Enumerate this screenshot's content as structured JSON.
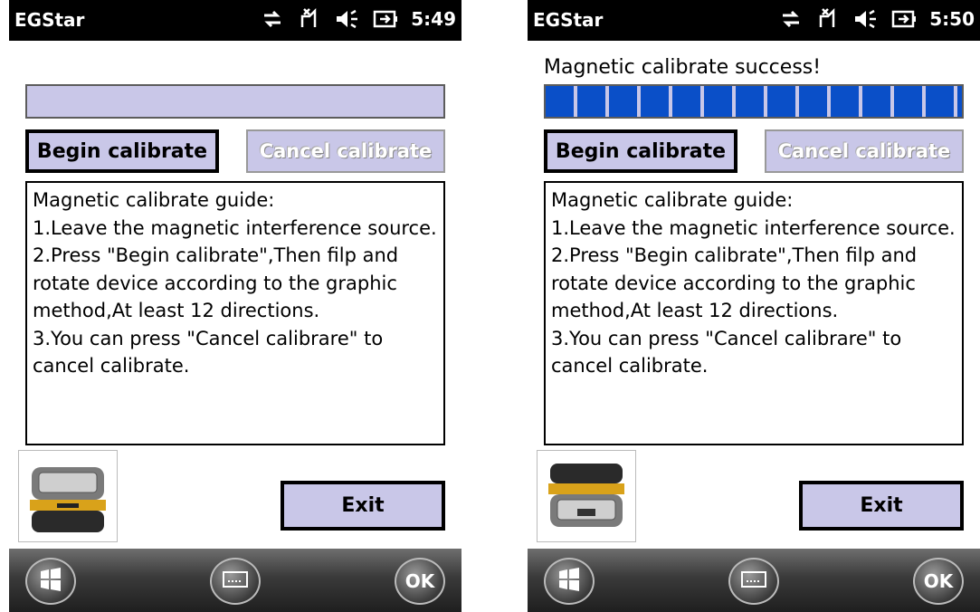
{
  "screens": [
    {
      "app_title": "EGStar",
      "time": "5:49",
      "message": "",
      "progress_percent": 0,
      "begin_label": "Begin calibrate",
      "cancel_label": "Cancel calibrate",
      "guide_lines": [
        "Magnetic calibrate guide:",
        "1.Leave the magnetic interference source.",
        "2.Press \"Begin calibrate\",Then filp and rotate device according to the graphic method,At least 12 directions.",
        "3.You can press \"Cancel calibrare\" to cancel calibrate."
      ],
      "exit_label": "Exit",
      "ok_label": "OK"
    },
    {
      "app_title": "EGStar",
      "time": "5:50",
      "message": "Magnetic calibrate success!",
      "progress_percent": 100,
      "begin_label": "Begin calibrate",
      "cancel_label": "Cancel calibrate",
      "guide_lines": [
        "Magnetic calibrate guide:",
        "1.Leave the magnetic interference source.",
        "2.Press \"Begin calibrate\",Then filp and rotate device according to the graphic method,At least 12 directions.",
        "3.You can press \"Cancel calibrare\" to cancel calibrate."
      ],
      "exit_label": "Exit",
      "ok_label": "OK"
    }
  ],
  "colors": {
    "button_fill": "#c9c7e8",
    "progress_blue": "#0a4fc8",
    "titlebar": "#000000"
  },
  "icons": [
    "connectivity-icon",
    "signal-off-icon",
    "speaker-icon",
    "battery-icon",
    "windows-start-icon",
    "keyboard-icon",
    "device-image"
  ]
}
